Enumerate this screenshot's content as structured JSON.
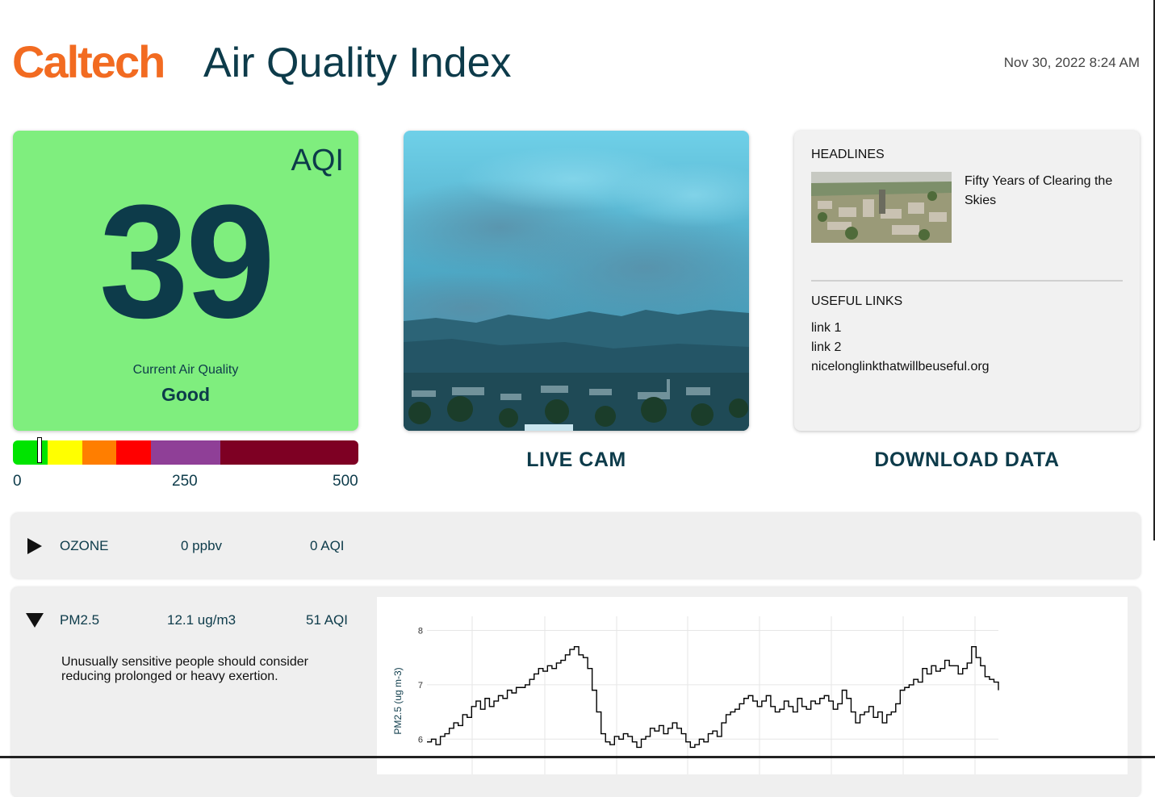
{
  "header": {
    "logo_text": "Caltech",
    "title": "Air Quality Index",
    "timestamp": "Nov 30, 2022 8:24 AM"
  },
  "aqi": {
    "label": "AQI",
    "value": "39",
    "caption": "Current Air Quality",
    "category": "Good",
    "card_color": "#7fee7e"
  },
  "scale": {
    "marker_value": 39,
    "segments": [
      {
        "upto": 50,
        "color": "#00e400"
      },
      {
        "upto": 100,
        "color": "#ffff00"
      },
      {
        "upto": 150,
        "color": "#ff7e00"
      },
      {
        "upto": 200,
        "color": "#ff0000"
      },
      {
        "upto": 300,
        "color": "#8f3f97"
      },
      {
        "upto": 500,
        "color": "#7e0023"
      }
    ],
    "ticks": [
      "0",
      "250",
      "500"
    ]
  },
  "live_cam": {
    "label": "LIVE CAM"
  },
  "download": {
    "label": "DOWNLOAD DATA"
  },
  "news": {
    "headlines_heading": "HEADLINES",
    "headline": "Fifty Years of Clearing the Skies",
    "useful_heading": "USEFUL LINKS",
    "links": [
      "link 1",
      "link 2",
      "nicelonglinkthatwillbeuseful.org"
    ]
  },
  "pollutants": [
    {
      "name": "OZONE",
      "concentration": "0 ppbv",
      "aqi": "0 AQI",
      "expanded": false,
      "icon": "triangle-right-icon"
    },
    {
      "name": "PM2.5",
      "concentration": "12.1 ug/m3",
      "aqi": "51 AQI",
      "expanded": true,
      "icon": "triangle-down-icon",
      "note": "Unusually sensitive people should consider reducing prolonged or heavy exertion."
    }
  ],
  "chart_data": {
    "type": "line",
    "ylabel": "PM2.5 (ug m-3)",
    "yticks": [
      "6",
      "7",
      "8"
    ],
    "ylim": [
      5.5,
      8.2
    ],
    "series": [
      {
        "values": [
          5.95,
          6.0,
          5.9,
          6.05,
          6.1,
          6.2,
          6.3,
          6.25,
          6.45,
          6.4,
          6.6,
          6.7,
          6.55,
          6.75,
          6.6,
          6.7,
          6.8,
          6.75,
          6.9,
          6.85,
          6.95,
          6.95,
          7.0,
          7.1,
          7.2,
          7.3,
          7.25,
          7.35,
          7.3,
          7.4,
          7.45,
          7.55,
          7.65,
          7.7,
          7.55,
          7.5,
          7.3,
          6.9,
          6.5,
          6.1,
          5.95,
          5.9,
          6.05,
          6.0,
          6.1,
          6.05,
          5.95,
          5.85,
          6.0,
          6.05,
          6.2,
          6.15,
          6.25,
          6.1,
          6.2,
          6.3,
          6.2,
          6.1,
          5.95,
          5.85,
          5.9,
          6.0,
          5.95,
          6.1,
          6.15,
          6.05,
          6.3,
          6.45,
          6.5,
          6.55,
          6.65,
          6.75,
          6.8,
          6.7,
          6.6,
          6.7,
          6.8,
          6.6,
          6.5,
          6.55,
          6.7,
          6.6,
          6.5,
          6.75,
          6.6,
          6.55,
          6.7,
          6.65,
          6.75,
          6.8,
          6.7,
          6.55,
          6.65,
          6.9,
          6.75,
          6.5,
          6.3,
          6.45,
          6.5,
          6.6,
          6.4,
          6.5,
          6.3,
          6.45,
          6.5,
          6.65,
          6.9,
          6.95,
          7.0,
          7.1,
          7.05,
          7.3,
          7.2,
          7.35,
          7.25,
          7.3,
          7.45,
          7.35,
          7.35,
          7.2,
          7.3,
          7.4,
          7.7,
          7.5,
          7.35,
          7.15,
          7.1,
          7.05,
          6.9
        ]
      }
    ]
  }
}
